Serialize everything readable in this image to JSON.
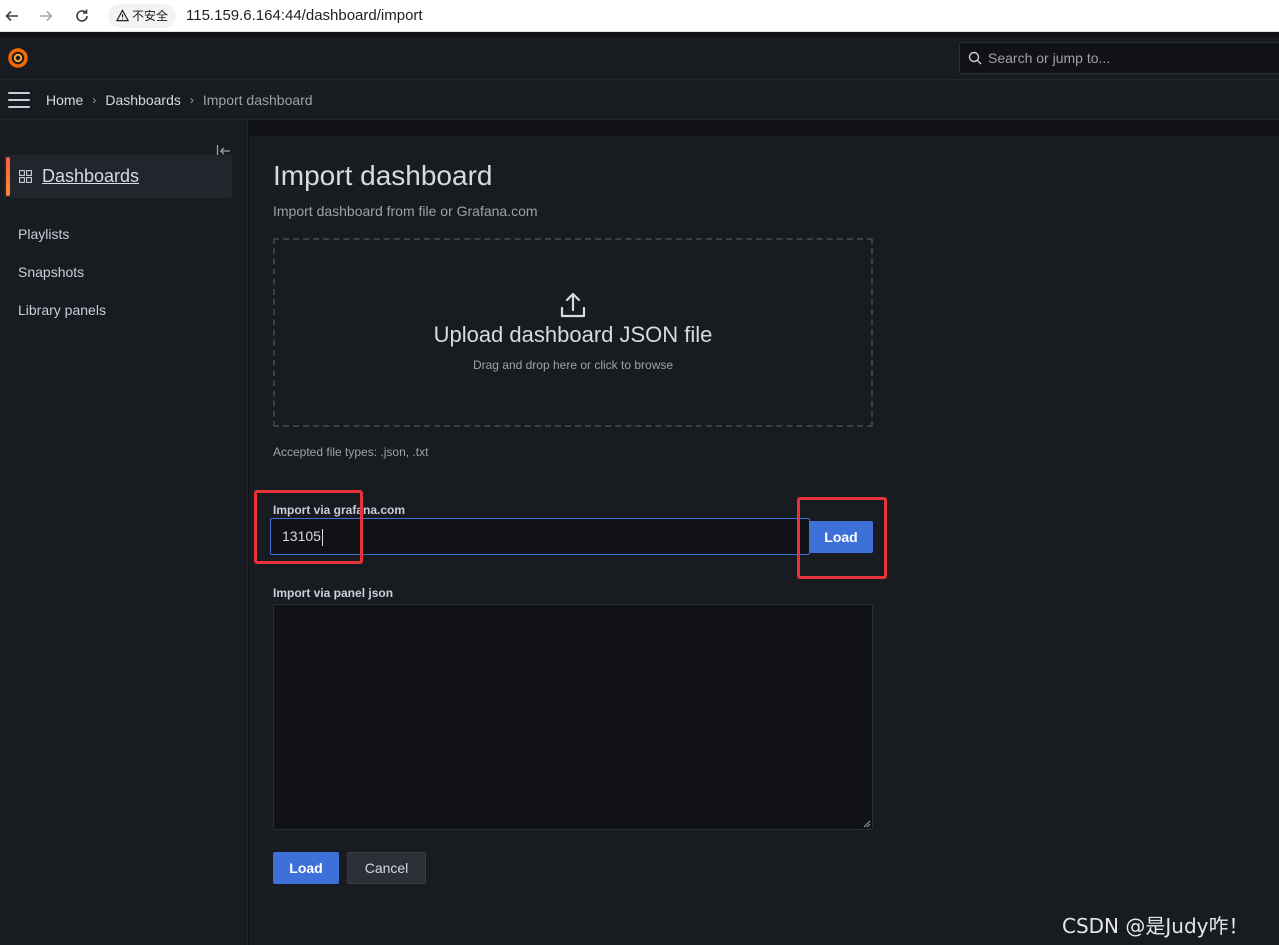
{
  "browser": {
    "security_label": "不安全",
    "url": "115.159.6.164:44/dashboard/import"
  },
  "topbar": {
    "search_placeholder": "Search or jump to..."
  },
  "breadcrumb": {
    "items": [
      "Home",
      "Dashboards",
      "Import dashboard"
    ]
  },
  "sidebar": {
    "active": "Dashboards",
    "items": [
      "Playlists",
      "Snapshots",
      "Library panels"
    ]
  },
  "main": {
    "title": "Import dashboard",
    "subtitle": "Import dashboard from file or Grafana.com",
    "upload_title": "Upload dashboard JSON file",
    "upload_hint": "Drag and drop here or click to browse",
    "accepted_types": "Accepted file types: .json, .txt",
    "gcom_label": "Import via grafana.com",
    "gcom_value": "13105",
    "gcom_load": "Load",
    "panel_json_label": "Import via panel json",
    "load_label": "Load",
    "cancel_label": "Cancel"
  },
  "watermark": "CSDN @是Judy咋！",
  "colors": {
    "accent": "#3d71d9",
    "highlight": "#e8333a",
    "brand": "#f46800"
  }
}
